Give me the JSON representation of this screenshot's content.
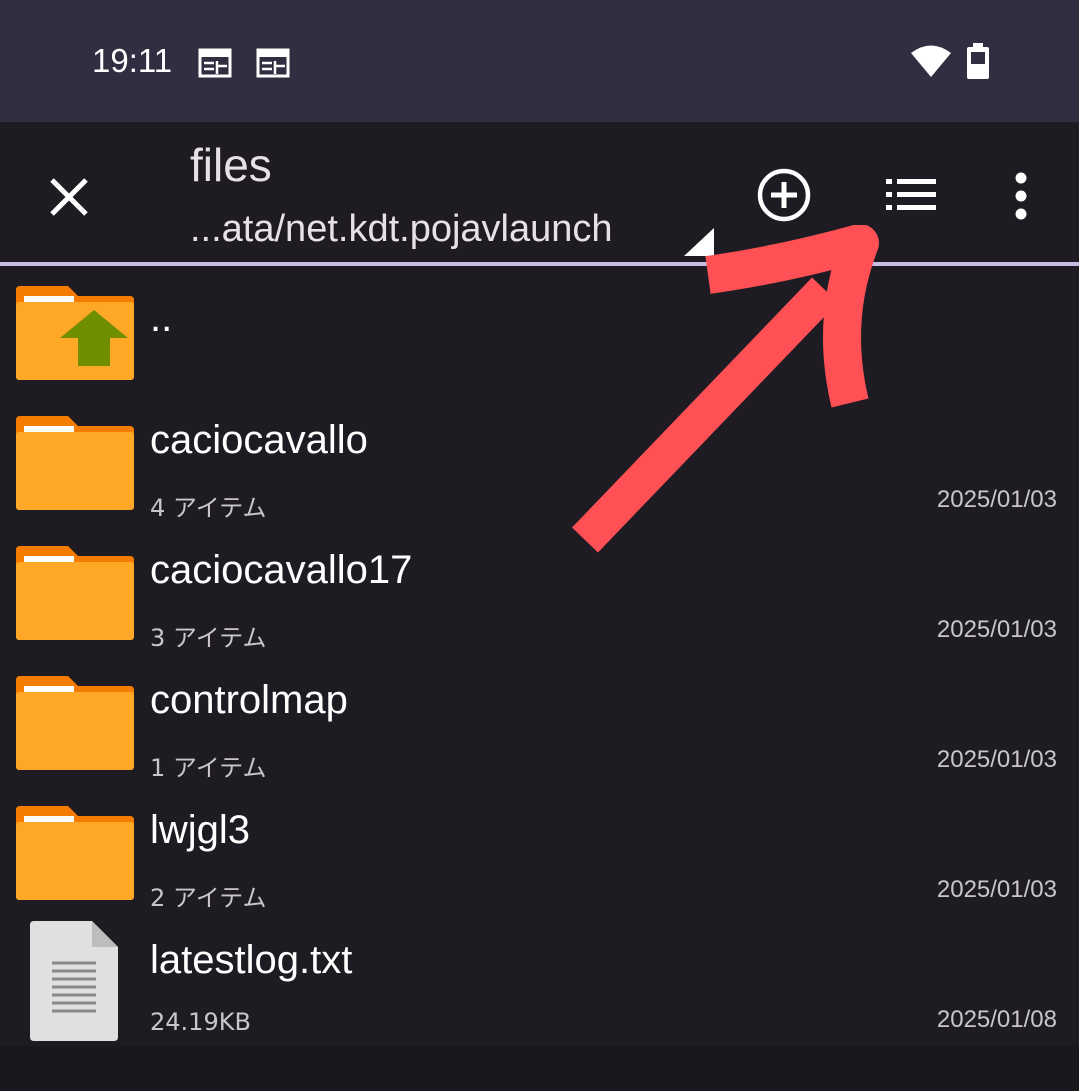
{
  "status_bar": {
    "time": "19:11",
    "icons": [
      "calendar-icon",
      "calendar-icon",
      "wifi-icon",
      "battery-icon"
    ]
  },
  "toolbar": {
    "title": "files",
    "path": "...ata/net.kdt.pojavlaunch",
    "close_icon": "close-icon",
    "add_icon": "add-circle-icon",
    "view_icon": "list-view-icon",
    "more_icon": "more-vert-icon"
  },
  "files": [
    {
      "name": "..",
      "meta": "",
      "date": "",
      "icon": "folder-up-icon"
    },
    {
      "name": "caciocavallo",
      "meta": "4 アイテム",
      "date": "2025/01/03",
      "icon": "folder-icon"
    },
    {
      "name": "caciocavallo17",
      "meta": "3 アイテム",
      "date": "2025/01/03",
      "icon": "folder-icon"
    },
    {
      "name": "controlmap",
      "meta": "1 アイテム",
      "date": "2025/01/03",
      "icon": "folder-icon"
    },
    {
      "name": "lwjgl3",
      "meta": "2 アイテム",
      "date": "2025/01/03",
      "icon": "folder-icon"
    },
    {
      "name": "latestlog.txt",
      "meta": "24.19KB",
      "date": "2025/01/08",
      "icon": "text-file-icon"
    }
  ],
  "colors": {
    "status_bar_bg": "#332d41",
    "background": "#1e1c22",
    "folder": "#ffa726",
    "folder_tab": "#f57c00",
    "annotation_arrow": "#ff5055",
    "divider": "#cbbbe8"
  }
}
